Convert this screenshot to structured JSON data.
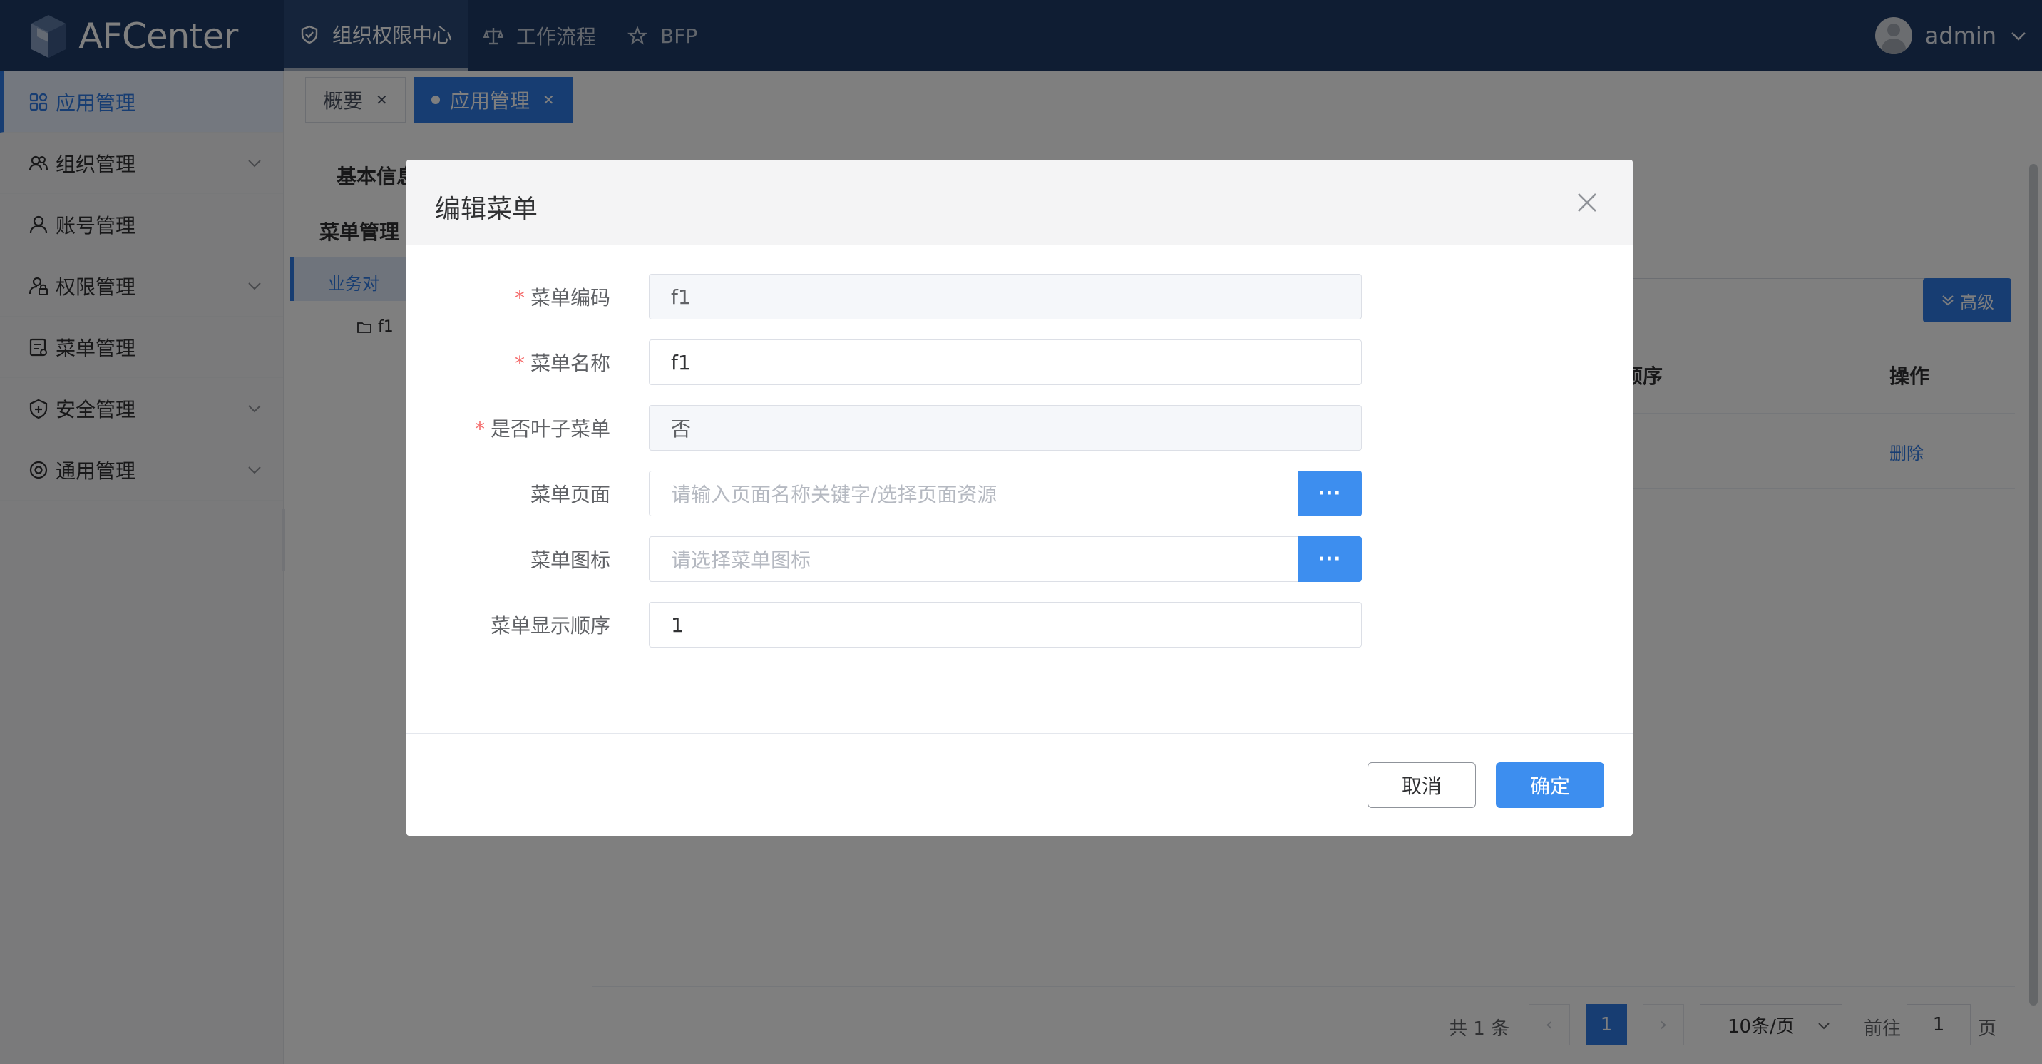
{
  "header": {
    "logo_text": "AFCenter",
    "nav": [
      {
        "label": "组织权限中心",
        "icon": "shield-icon",
        "active": true
      },
      {
        "label": "工作流程",
        "icon": "balance-icon",
        "active": false
      },
      {
        "label": "BFP",
        "icon": "star-icon",
        "active": false
      }
    ],
    "user": "admin"
  },
  "sidebar": {
    "items": [
      {
        "label": "应用管理",
        "icon": "grid-icon",
        "active": true,
        "expandable": false
      },
      {
        "label": "组织管理",
        "icon": "users-icon",
        "active": false,
        "expandable": true
      },
      {
        "label": "账号管理",
        "icon": "user-icon",
        "active": false,
        "expandable": false
      },
      {
        "label": "权限管理",
        "icon": "user-lock-icon",
        "active": false,
        "expandable": true
      },
      {
        "label": "菜单管理",
        "icon": "menu-list-icon",
        "active": false,
        "expandable": false
      },
      {
        "label": "安全管理",
        "icon": "shield-plus-icon",
        "active": false,
        "expandable": true
      },
      {
        "label": "通用管理",
        "icon": "settings-icon",
        "active": false,
        "expandable": true
      }
    ]
  },
  "tabs": [
    {
      "label": "概要",
      "active": false
    },
    {
      "label": "应用管理",
      "active": true
    }
  ],
  "background": {
    "basic_info_label": "基本信息",
    "menu_mgmt_label": "菜单管理",
    "tree_selected": "业务对",
    "tree_child": "f1",
    "advanced_button": "高级",
    "table_headers": [
      "顺序",
      "操作"
    ],
    "row_action": "删除",
    "pager": {
      "total": "共 1 条",
      "current_page": "1",
      "page_size": "10条/页",
      "goto_label": "前往",
      "goto_value": "1",
      "page_suffix": "页"
    }
  },
  "dialog": {
    "title": "编辑菜单",
    "fields": [
      {
        "label": "菜单编码",
        "required": true,
        "value": "f1",
        "placeholder": "",
        "disabled": true
      },
      {
        "label": "菜单名称",
        "required": true,
        "value": "f1",
        "placeholder": "",
        "disabled": false
      },
      {
        "label": "是否叶子菜单",
        "required": true,
        "value": "否",
        "placeholder": "",
        "disabled": true
      },
      {
        "label": "菜单页面",
        "required": false,
        "value": "",
        "placeholder": "请输入页面名称关键字/选择页面资源",
        "disabled": false,
        "button": "···"
      },
      {
        "label": "菜单图标",
        "required": false,
        "value": "",
        "placeholder": "请选择菜单图标",
        "disabled": false,
        "button": "···"
      },
      {
        "label": "菜单显示顺序",
        "required": false,
        "value": "1",
        "placeholder": "",
        "disabled": false
      }
    ],
    "cancel_label": "取消",
    "confirm_label": "确定",
    "required_mark": "*"
  },
  "colors": {
    "header_bg": "#1f3a67",
    "primary": "#2f7ae5",
    "button_primary": "#3d8eef",
    "required": "#f56c6c"
  }
}
